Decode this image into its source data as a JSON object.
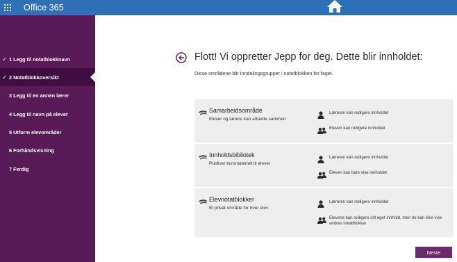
{
  "colors": {
    "topbar": "#2f6fb5",
    "sidebar": "#591a58",
    "sidebar_active": "#3f0d3f",
    "section_bg": "#eeeeee",
    "primary_button": "#6b2a6a"
  },
  "topbar": {
    "app_title": "Office 365",
    "launcher_icon": "waffle-grid-icon",
    "home_icon": "home-icon"
  },
  "sidebar": {
    "steps": [
      {
        "label": "1  Legg til notatblokknavn",
        "completed": true,
        "active": false
      },
      {
        "label": "2  Notatblokkoversikt",
        "completed": true,
        "active": true
      },
      {
        "label": "3  Legg til en annen lærer",
        "completed": false,
        "active": false
      },
      {
        "label": "4  Legg til navn på elever",
        "completed": false,
        "active": false
      },
      {
        "label": "5  Utform elevområder",
        "completed": false,
        "active": false
      },
      {
        "label": "6  Forhåndsvisning",
        "completed": false,
        "active": false
      },
      {
        "label": "7  Ferdig",
        "completed": false,
        "active": false
      }
    ],
    "check_glyph": "✓"
  },
  "main": {
    "back_icon": "back-arrow-icon",
    "title": "Flott! Vi oppretter Jepp for deg. Dette blir innholdet:",
    "subtitle": "Disse områdene blir inndelingsgrupper i notatblokken for faget.",
    "sections": [
      {
        "title": "Samarbeidsområde",
        "description": "Elever og lærere kan arbeide sammen",
        "teacher_permission": "Læreren kan redigere innholdet",
        "student_permission": "Eleven kan redigere innholdet"
      },
      {
        "title": "Innholdsbibliotek",
        "description": "Publiser kursmateriell til elever",
        "teacher_permission": "Læreren kan redigere innholdet",
        "student_permission": "Eleven kan bare vise innholdet"
      },
      {
        "title": "Elevnotatblokker",
        "description": "Et privat område for hver elev",
        "teacher_permission": "Læreren kan redigere innholdet",
        "student_permission": "Elevene kan redigere sitt eget innhold, men de kan ikke vise andres notatblokker"
      }
    ],
    "next_button": "Neste"
  }
}
